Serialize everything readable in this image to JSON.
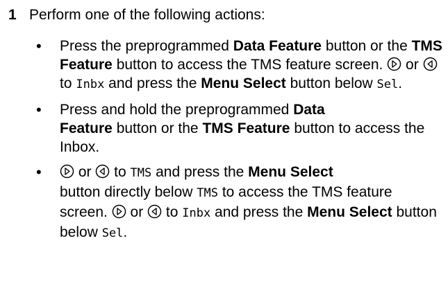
{
  "step": {
    "number": "1",
    "intro": "Perform one of the following actions:"
  },
  "bullet_symbol": "•",
  "terms": {
    "data_feature": "Data Feature",
    "tms_feature": "TMS Feature",
    "menu_select": "Menu Select",
    "data": "Data",
    "feature": "Feature",
    "inbx": "Inbx",
    "sel": "Sel",
    "tms": "TMS"
  },
  "bullets": [
    {
      "t1": "Press the preprogrammed ",
      "t2": " button or the ",
      "t3": " button to access the TMS feature screen. ",
      "or1": " or ",
      "to1": " to ",
      "t4": " and press the ",
      "t5": " button below ",
      "end": "."
    },
    {
      "t1": "Press and hold the preprogrammed ",
      "t2": " button or the ",
      "t3": " button to access the Inbox."
    },
    {
      "or1": " or ",
      "to1": " to ",
      "t2": " and press the ",
      "t3": " button directly below ",
      "t4": " to access the TMS feature screen. ",
      "or2": " or ",
      "to2": " to ",
      "t5": " and press the ",
      "t6": " button below ",
      "end": "."
    }
  ],
  "icons": {
    "right": "nav-right-icon",
    "left": "nav-left-icon"
  }
}
